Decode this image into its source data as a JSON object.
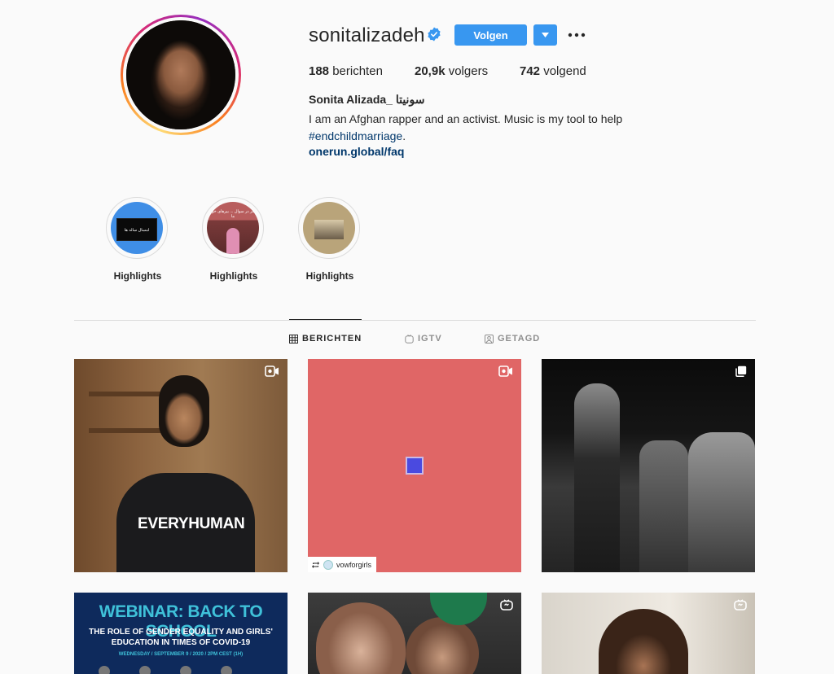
{
  "profile": {
    "username": "sonitalizadeh",
    "follow_label": "Volgen",
    "posts_count": "188",
    "posts_label": "berichten",
    "followers_count": "20,9k",
    "followers_label": "volgers",
    "following_count": "742",
    "following_label": "volgend",
    "full_name": "Sonita Alizada_ سونیتا",
    "bio_line": "I am an Afghan rapper and an activist. Music is my tool to help",
    "bio_hashtag": "#endchildmarriage",
    "bio_end": ".",
    "website": "onerun.global/faq"
  },
  "highlights": [
    {
      "label": "Highlights",
      "overlay_text": "امسال ساله ها"
    },
    {
      "label": "Highlights",
      "overlay_text": "دختر در سوال ... بیرهای خوب ما"
    },
    {
      "label": "Highlights"
    }
  ],
  "tabs": [
    {
      "label": "BERICHTEN",
      "icon": "grid-icon",
      "active": true
    },
    {
      "label": "IGTV",
      "icon": "igtv-icon",
      "active": false
    },
    {
      "label": "GETAGD",
      "icon": "tagged-icon",
      "active": false
    }
  ],
  "posts": [
    {
      "kind": "video",
      "shirt_text": "EVERYHUMAN"
    },
    {
      "kind": "video",
      "tag_user": "vowforgirls"
    },
    {
      "kind": "carousel"
    },
    {
      "kind": "image",
      "title": "WEBINAR: BACK TO SCHOOL",
      "subtitle1": "THE ROLE OF GENDER EQUALITY AND GIRLS'",
      "subtitle2": "EDUCATION IN TIMES OF COVID-19",
      "date_line": "WEDNESDAY / SEPTEMBER 9 / 2020 / 2PM CEST (1H)"
    },
    {
      "kind": "igtv"
    },
    {
      "kind": "igtv"
    }
  ],
  "colors": {
    "accent": "#3897f0",
    "link": "#00376b",
    "post2_bg": "#e06666",
    "webinar_bg": "#0e2a5c",
    "webinar_title": "#3fc1d9"
  }
}
